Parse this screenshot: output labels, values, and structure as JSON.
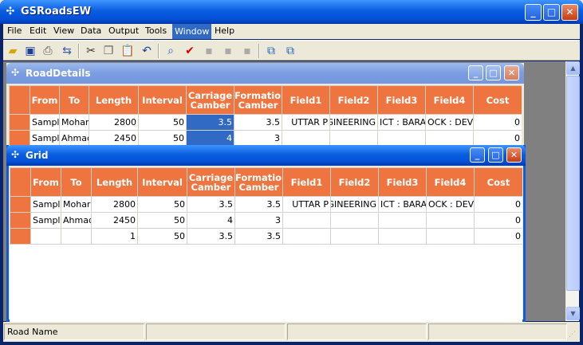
{
  "app": {
    "title": "GSRoadsEW"
  },
  "menu": [
    "File",
    "Edit",
    "View",
    "Data",
    "Output",
    "Tools",
    "Window",
    "Help"
  ],
  "menu_active": "Window",
  "toolbar_icons": [
    "open-icon",
    "save-icon",
    "print-icon",
    "transfer-icon",
    "cut-icon",
    "copy-icon",
    "paste-icon",
    "undo-icon",
    "find-icon",
    "check-icon",
    "blank-icon-1",
    "blank-icon-2",
    "blank-icon-3",
    "tile-icon",
    "cascade-icon"
  ],
  "road_details": {
    "title": "RoadDetails",
    "columns": [
      "From",
      "To",
      "Length",
      "Interval",
      "Carriage Camber",
      "Formation Camber",
      "Field1",
      "Field2",
      "Field3",
      "Field4",
      "Cost"
    ],
    "rows": [
      [
        "Sampl",
        "Mohar",
        "2800",
        "50",
        "3.5",
        "3.5",
        "UTTAR P",
        "GINEERING",
        "ICT : BARA",
        "OCK : DEV",
        "0"
      ],
      [
        "Sampl",
        "Ahmad",
        "2450",
        "50",
        "4",
        "3",
        "",
        "",
        "",
        "",
        "0"
      ]
    ]
  },
  "grid": {
    "title": "Grid",
    "columns": [
      "From",
      "To",
      "Length",
      "Interval",
      "Carriage Camber",
      "Formation Camber",
      "Field1",
      "Field2",
      "Field3",
      "Field4",
      "Cost"
    ],
    "rows": [
      [
        "Sampl",
        "Mohar",
        "2800",
        "50",
        "3.5",
        "3.5",
        "UTTAR P",
        "GINEERING",
        "ICT : BARA",
        "OCK : DEV",
        "0"
      ],
      [
        "Sampl",
        "Ahmad",
        "2450",
        "50",
        "4",
        "3",
        "",
        "",
        "",
        "",
        "0"
      ],
      [
        "",
        "",
        "1",
        "50",
        "3.5",
        "3.5",
        "",
        "",
        "",
        "",
        "0"
      ]
    ]
  },
  "status": {
    "pane1": "Road Name",
    "pane2": "",
    "pane3": "",
    "pane4": "",
    "pane5": ""
  }
}
